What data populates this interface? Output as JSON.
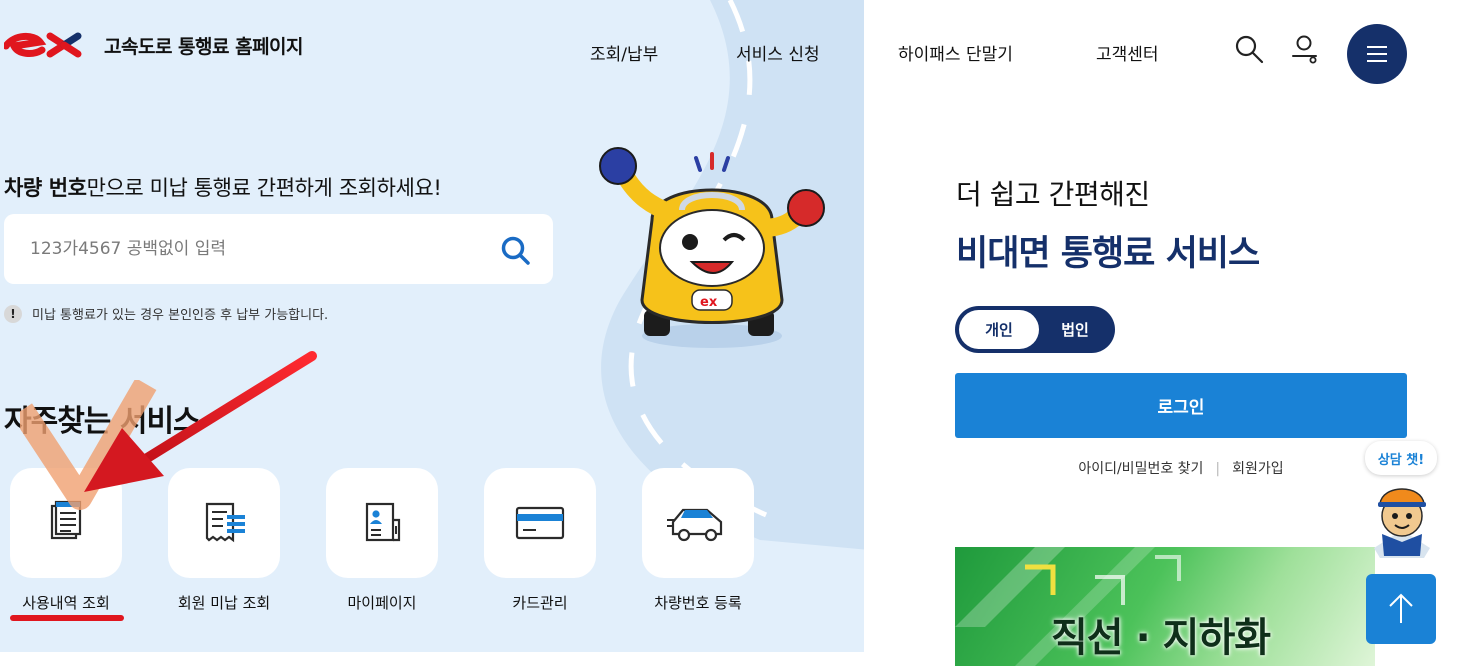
{
  "header": {
    "logo_text": "고속도로 통행료 홈페이지",
    "nav": [
      {
        "label": "조회/납부"
      },
      {
        "label": "서비스 신청"
      },
      {
        "label": "하이패스 단말기"
      },
      {
        "label": "고객센터"
      }
    ]
  },
  "search": {
    "headline_bold": "차량 번호",
    "headline_rest": "만으로 미납 통행료 간편하게 조회하세요!",
    "placeholder": "123가4567 공백없이 입력",
    "notice_icon": "!",
    "notice": "미납 통행료가 있는 경우 본인인증 후 납부 가능합니다."
  },
  "services": {
    "title": "자주찾는 서비스",
    "items": [
      {
        "label": "사용내역 조회",
        "icon": "document-list-icon"
      },
      {
        "label": "회원 미납 조회",
        "icon": "receipt-icon"
      },
      {
        "label": "마이페이지",
        "icon": "profile-card-icon"
      },
      {
        "label": "카드관리",
        "icon": "credit-card-icon"
      },
      {
        "label": "차량번호 등록",
        "icon": "car-icon"
      }
    ]
  },
  "right": {
    "subtitle": "더 쉽고 간편해진",
    "title": "비대면 통행료 서비스",
    "toggle": {
      "personal": "개인",
      "corporate": "법인"
    },
    "login": "로그인",
    "find_account": "아이디/비밀번호 찾기",
    "separator": "|",
    "signup": "회원가입",
    "banner_text": "직선 · 지하화"
  },
  "chat": {
    "bubble": "상담 챗!"
  },
  "colors": {
    "navy": "#15306a",
    "blue": "#1a82d6",
    "hero_bg": "#e2effb",
    "brand_red": "#e0161e",
    "highlight_red": "#e0161e"
  }
}
